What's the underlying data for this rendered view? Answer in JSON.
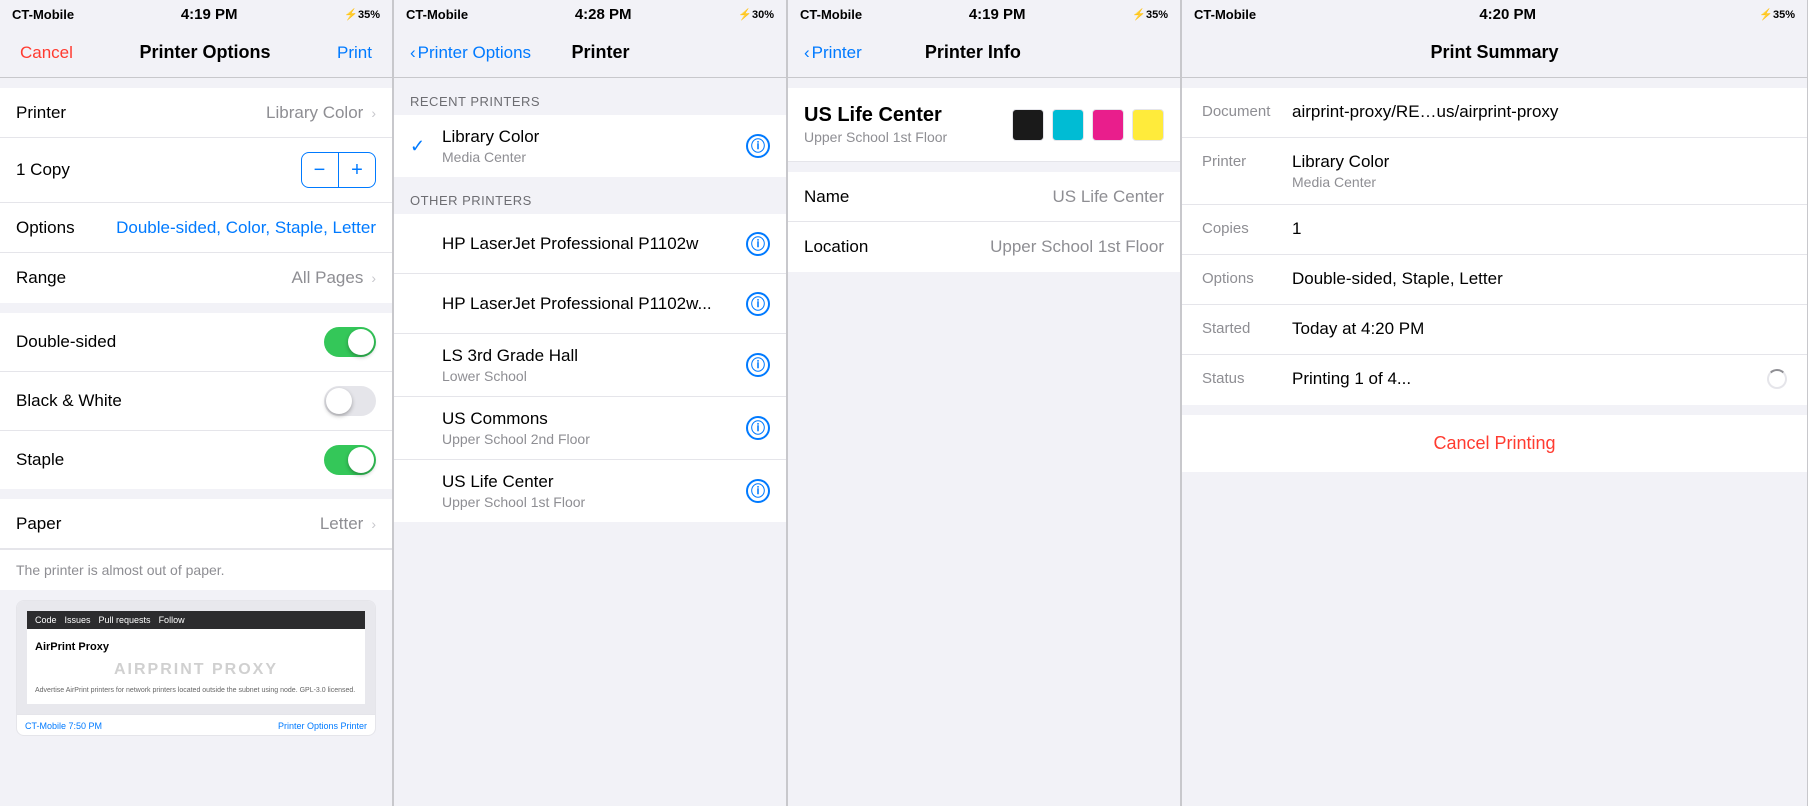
{
  "panels": [
    {
      "id": "printer-options",
      "statusBar": {
        "carrier": "CT-Mobile",
        "time": "4:19 PM",
        "battery": "35%"
      },
      "navBar": {
        "cancelLabel": "Cancel",
        "title": "Printer Options",
        "printLabel": "Print"
      },
      "rows": [
        {
          "label": "Printer",
          "value": "Library Color",
          "type": "nav"
        },
        {
          "label": "1 Copy",
          "value": "",
          "type": "stepper"
        },
        {
          "label": "Options",
          "value": "Double-sided, Color, Staple, Letter",
          "type": "text-blue"
        },
        {
          "label": "Range",
          "value": "All Pages",
          "type": "nav"
        }
      ],
      "toggles": [
        {
          "label": "Double-sided",
          "on": true
        },
        {
          "label": "Black & White",
          "on": false
        },
        {
          "label": "Staple",
          "on": true
        }
      ],
      "paperRow": {
        "label": "Paper",
        "value": "Letter"
      },
      "warningText": "The printer is almost out of paper.",
      "docPreview": {
        "headerItems": [
          "Code",
          "Issues",
          "Pull requests",
          "Follow"
        ],
        "title": "AirPrint Proxy",
        "bigText": "AIRPRINT PROXY",
        "smallText": "Advertise AirPrint printers for network printers located outside the subnet using node. GPL-3.0 licensed.",
        "footerLeft": "CT-Mobile",
        "footerTime": "7:50 PM",
        "footerRight": "Printer Options   Printer"
      }
    },
    {
      "id": "printer-select",
      "statusBar": {
        "carrier": "CT-Mobile",
        "time": "4:28 PM",
        "battery": "30%"
      },
      "navBar": {
        "backLabel": "Printer Options",
        "title": "Printer"
      },
      "recentSection": "RECENT PRINTERS",
      "recentPrinters": [
        {
          "name": "Library Color",
          "sub": "Media Center",
          "selected": true
        }
      ],
      "otherSection": "OTHER PRINTERS",
      "otherPrinters": [
        {
          "name": "HP LaserJet Professional P1102w",
          "sub": ""
        },
        {
          "name": "HP LaserJet Professional P1102w...",
          "sub": ""
        },
        {
          "name": "LS 3rd Grade Hall",
          "sub": "Lower School"
        },
        {
          "name": "US Commons",
          "sub": "Upper School 2nd Floor"
        },
        {
          "name": "US Life Center",
          "sub": "Upper School 1st Floor"
        }
      ]
    },
    {
      "id": "printer-info",
      "statusBar": {
        "carrier": "CT-Mobile",
        "time": "4:19 PM",
        "battery": "35%"
      },
      "navBar": {
        "backLabel": "Printer",
        "title": "Printer Info"
      },
      "printerName": "US Life Center",
      "printerSub": "Upper School 1st Floor",
      "inkColors": [
        {
          "color": "#1a1a1a",
          "label": "black"
        },
        {
          "color": "#00bcd4",
          "label": "cyan"
        },
        {
          "color": "#e91e8c",
          "label": "magenta"
        },
        {
          "color": "#ffeb3b",
          "label": "yellow"
        }
      ],
      "infoRows": [
        {
          "label": "Name",
          "value": "US Life Center"
        },
        {
          "label": "Location",
          "value": "Upper School 1st Floor"
        }
      ]
    },
    {
      "id": "print-summary",
      "statusBar": {
        "carrier": "CT-Mobile",
        "time": "4:20 PM",
        "battery": "35%"
      },
      "navBar": {
        "title": "Print Summary"
      },
      "summaryRows": [
        {
          "label": "Document",
          "value": "airprint-proxy/RE…us/airprint-proxy",
          "sub": ""
        },
        {
          "label": "Printer",
          "value": "Library Color",
          "sub": "Media Center"
        },
        {
          "label": "Copies",
          "value": "1",
          "sub": ""
        },
        {
          "label": "Options",
          "value": "Double-sided, Staple, Letter",
          "sub": ""
        },
        {
          "label": "Started",
          "value": "Today at 4:20 PM",
          "sub": ""
        },
        {
          "label": "Status",
          "value": "Printing 1 of 4...",
          "sub": "",
          "spinner": true
        }
      ],
      "cancelPrintingLabel": "Cancel Printing"
    }
  ]
}
